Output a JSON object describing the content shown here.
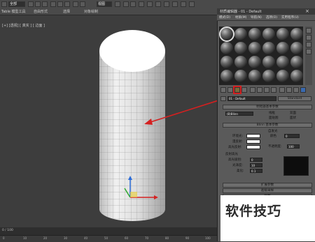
{
  "toolbar": {
    "select_filter": "全部",
    "view_mode": "视图"
  },
  "menubar": {
    "items": [
      "Table 模型工具",
      "选择",
      "对象绘制",
      "自由形式",
      "选择",
      "对象绘制"
    ]
  },
  "viewport": {
    "label": "[+] [透视] [ 真实 ] [ 边面 ]"
  },
  "timeline": {
    "frame": "0 / 100"
  },
  "ruler": {
    "ticks": [
      "0",
      "10",
      "20",
      "30",
      "40",
      "50",
      "60",
      "70",
      "80",
      "90",
      "100"
    ]
  },
  "material_editor": {
    "title": "材质编辑器 - 01 - Default",
    "menu": [
      "模式(D)",
      "材质(M)",
      "导航(N)",
      "选项(O)",
      "实用程序(U)"
    ],
    "material_name": "01 - Default",
    "material_type": "Standard",
    "rollouts": {
      "shader_basic": "明暗器基本参数",
      "blinn_basic": "Blinn 基本参数",
      "extended": "扩展参数",
      "supersampling": "超级采样",
      "maps": "贴图"
    },
    "shader": {
      "type": "(B)Blinn",
      "options": [
        "线框",
        "双面",
        "面贴图",
        "面状"
      ]
    },
    "blinn": {
      "ambient_label": "环境光:",
      "diffuse_label": "漫反射:",
      "specular_label": "高光反射:",
      "self_illum_label": "自发光",
      "color_label": "颜色",
      "color_value": "0",
      "opacity_label": "不透明度:",
      "opacity_value": "100",
      "specular_highlights": "反射高光",
      "specular_level_label": "高光级别:",
      "specular_level_value": "0",
      "glossiness_label": "光泽度:",
      "glossiness_value": "10",
      "soften_label": "柔化:",
      "soften_value": "0.1"
    }
  },
  "watermark": "软件技巧",
  "colors": {
    "accent_arrow": "#d42020",
    "viewport_bg": "#3d3d3d",
    "panel_bg": "#5a5a5a"
  }
}
